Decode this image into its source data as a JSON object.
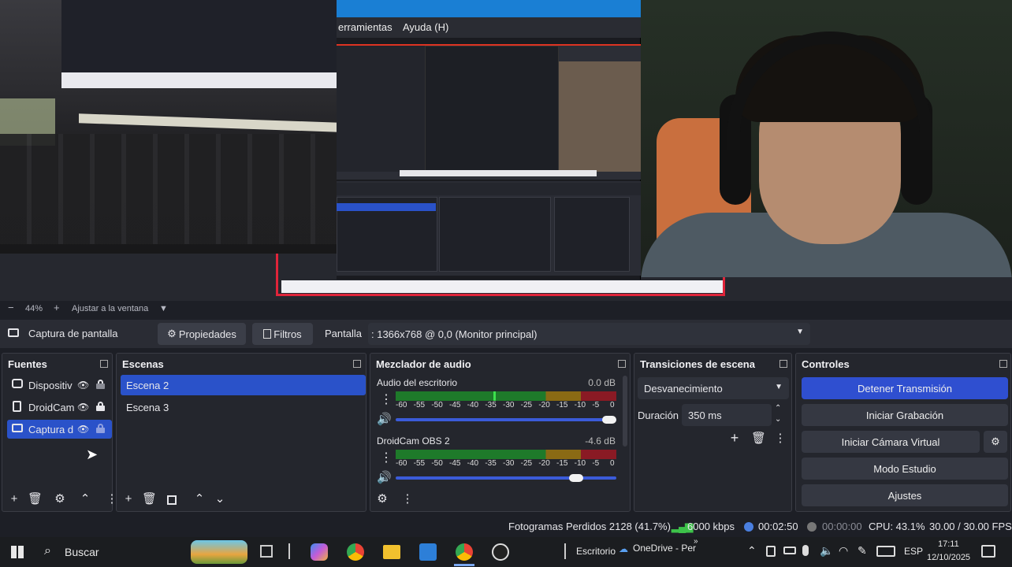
{
  "preview": {
    "nested_menu": [
      "erramientas",
      "Ayuda (H)"
    ],
    "zoom": "44%",
    "fit_label": "Ajustar a la ventana"
  },
  "sourcebar": {
    "source_name": "Captura de pantalla",
    "properties": "Propiedades",
    "filters": "Filtros",
    "display_label": "Pantalla",
    "display_value": ": 1366x768 @ 0,0 (Monitor principal)"
  },
  "sources": {
    "title": "Fuentes",
    "items": [
      {
        "label": "Dispositiv",
        "selected": false
      },
      {
        "label": "DroidCam",
        "selected": false
      },
      {
        "label": "Captura d",
        "selected": true
      }
    ]
  },
  "scenes": {
    "title": "Escenas",
    "items": [
      {
        "label": "Escena 2",
        "selected": true
      },
      {
        "label": "Escena 3",
        "selected": false
      }
    ]
  },
  "mixer": {
    "title": "Mezclador de audio",
    "ticks": [
      "-60",
      "-55",
      "-50",
      "-45",
      "-40",
      "-35",
      "-30",
      "-25",
      "-20",
      "-15",
      "-10",
      "-5",
      "0"
    ],
    "channels": [
      {
        "name": "Audio del escritorio",
        "db": "0.0 dB",
        "volume": 1.0
      },
      {
        "name": "DroidCam OBS 2",
        "db": "-4.6 dB",
        "volume": 0.84
      }
    ]
  },
  "transitions": {
    "title": "Transiciones de escena",
    "selected": "Desvanecimiento",
    "duration_label": "Duración",
    "duration_value": "350 ms"
  },
  "controls": {
    "title": "Controles",
    "stop_stream": "Detener Transmisión",
    "start_recording": "Iniciar Grabación",
    "virtual_cam": "Iniciar Cámara Virtual",
    "studio_mode": "Modo Estudio",
    "settings": "Ajustes"
  },
  "status": {
    "dropped": "Fotogramas Perdidos 2128 (41.7%)",
    "bitrate": "6000 kbps",
    "stream_time": "00:02:50",
    "rec_time": "00:00:00",
    "cpu": "CPU: 43.1%",
    "fps": "30.00 / 30.00 FPS"
  },
  "taskbar": {
    "search": "Buscar",
    "desktop": "Escritorio",
    "onedrive": "OneDrive - Per",
    "lang": "ESP",
    "time": "17:11",
    "date": "12/10/2025"
  },
  "colors": {
    "accent": "#2f4fd0",
    "selected_row": "#2a52c9",
    "meter_green": "#1e7a2a",
    "meter_yellow": "#8a6a14",
    "meter_red": "#8a1a24"
  }
}
